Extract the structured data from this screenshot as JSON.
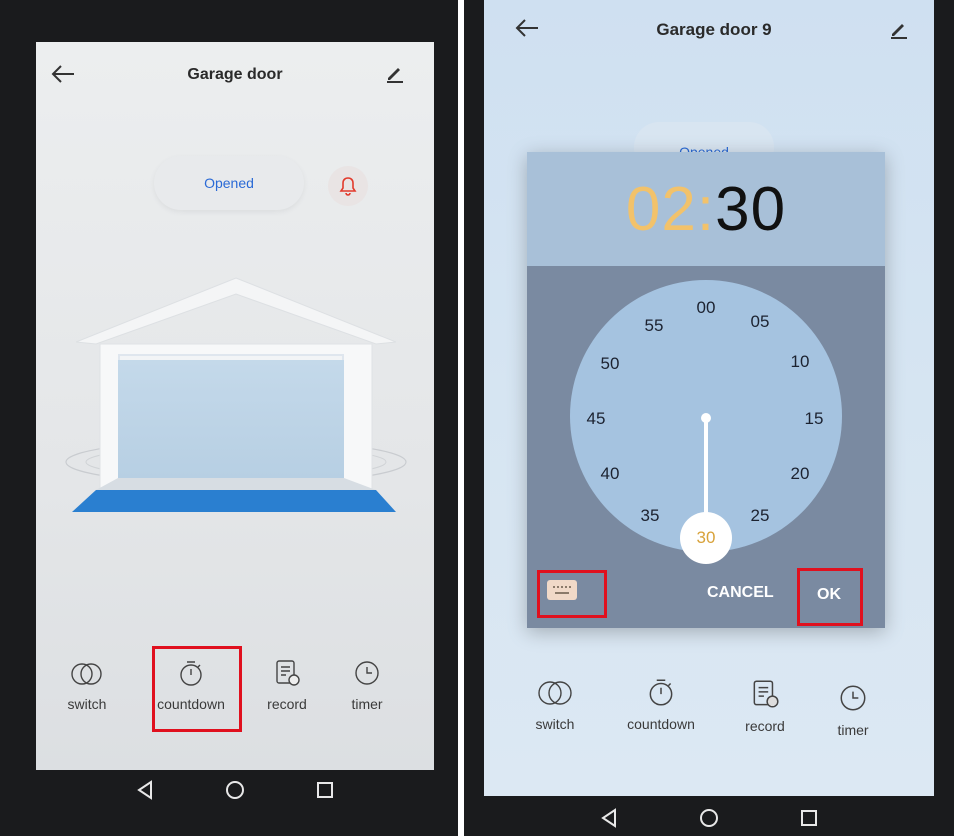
{
  "left": {
    "header": {
      "title": "Garage door"
    },
    "status": {
      "label": "Opened"
    },
    "toolbar": [
      {
        "label": "switch",
        "icon": "switch-icon"
      },
      {
        "label": "countdown",
        "icon": "countdown-icon"
      },
      {
        "label": "record",
        "icon": "record-icon"
      },
      {
        "label": "timer",
        "icon": "timer-icon"
      }
    ],
    "highlighted": "countdown"
  },
  "right": {
    "header": {
      "title": "Garage door 9"
    },
    "status": {
      "label": "Opened"
    },
    "time_picker": {
      "hours": "02",
      "separator": ":",
      "minutes": "30",
      "dial": [
        "00",
        "05",
        "10",
        "15",
        "20",
        "25",
        "30",
        "35",
        "40",
        "45",
        "50",
        "55"
      ],
      "selected": "30",
      "cancel_label": "CANCEL",
      "ok_label": "OK",
      "keyboard_icon": "keyboard-icon"
    },
    "toolbar": [
      {
        "label": "switch",
        "icon": "switch-icon"
      },
      {
        "label": "countdown",
        "icon": "countdown-icon"
      },
      {
        "label": "record",
        "icon": "record-icon"
      },
      {
        "label": "timer",
        "icon": "timer-icon"
      }
    ]
  },
  "colors": {
    "status_text": "#2a6ad6",
    "bell": "#e23a2c",
    "hours": "#f2c26b",
    "highlight": "#e0101e",
    "door_blue": "#2a7fd0"
  }
}
